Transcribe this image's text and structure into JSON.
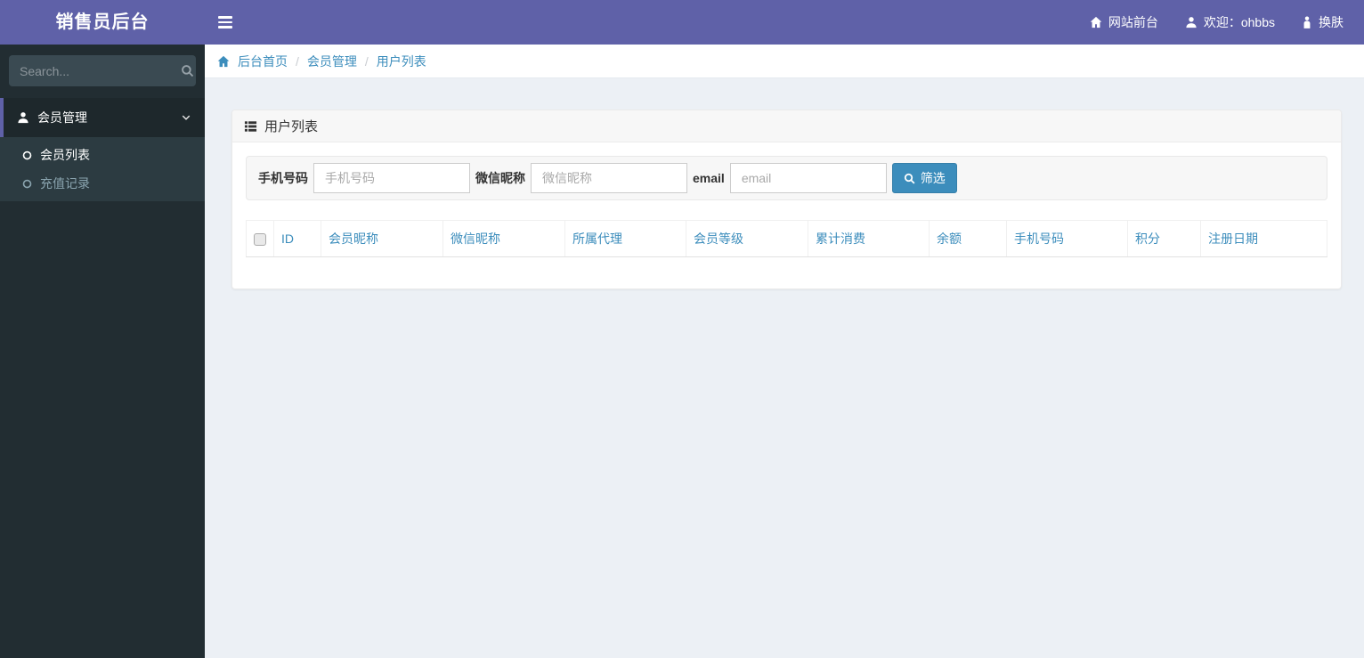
{
  "brand": "销售员后台",
  "navbar": {
    "links": [
      {
        "label": "网站前台",
        "icon": "home-icon"
      },
      {
        "label": "欢迎：ohbbs",
        "icon": "user-icon"
      },
      {
        "label": "换肤",
        "icon": "skin-icon"
      }
    ]
  },
  "sidebar": {
    "search_placeholder": "Search...",
    "menu": [
      {
        "label": "会员管理",
        "icon": "user-icon",
        "expanded": true,
        "children": [
          {
            "label": "会员列表",
            "active": true
          },
          {
            "label": "充值记录",
            "active": false
          }
        ]
      }
    ]
  },
  "breadcrumb": {
    "separator": "/",
    "items": [
      {
        "label": "后台首页"
      },
      {
        "label": "会员管理"
      },
      {
        "label": "用户列表"
      }
    ]
  },
  "panel": {
    "title": "用户列表"
  },
  "filter": {
    "fields": [
      {
        "label": "手机号码",
        "placeholder": "手机号码",
        "value": ""
      },
      {
        "label": "微信昵称",
        "placeholder": "微信昵称",
        "value": ""
      },
      {
        "label": "email",
        "placeholder": "email",
        "value": ""
      }
    ],
    "submit_label": "筛选"
  },
  "table": {
    "columns": [
      "ID",
      "会员昵称",
      "微信昵称",
      "所属代理",
      "会员等级",
      "累计消费",
      "余额",
      "手机号码",
      "积分",
      "注册日期"
    ],
    "rows": []
  },
  "colors": {
    "navbar_purple": "#5f61a8",
    "sidebar_dark": "#222d32",
    "submenu_dark": "#2c3b41",
    "active_item_dark": "#1e282c",
    "link_blue": "#3c8dbc",
    "button_blue": "#3c8dbc",
    "content_bg": "#ecf0f5"
  }
}
